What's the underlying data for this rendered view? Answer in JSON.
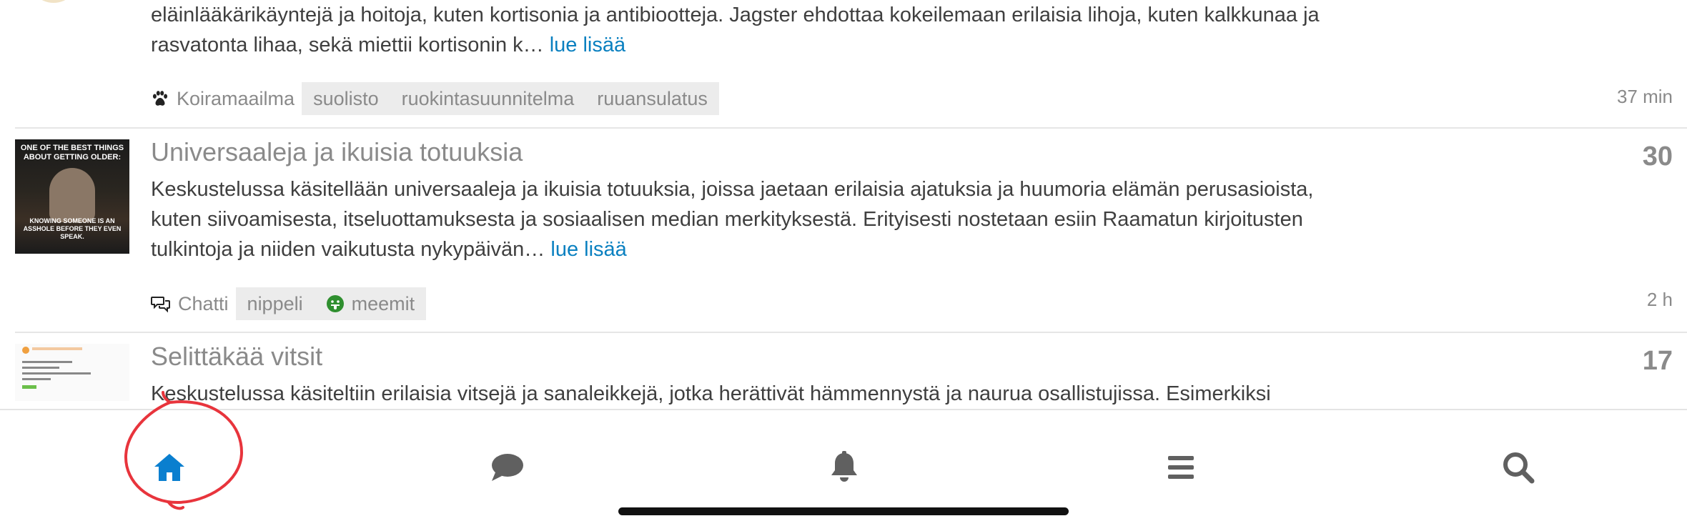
{
  "topics": [
    {
      "excerpt": "eläinlääkärikäyntejä ja hoitoja, kuten kortisonia ja antibiootteja. Jagster ehdottaa kokeilemaan erilaisia lihoja, kuten kalkkunaa ja rasvatonta lihaa, sekä miettii kortisonin k…",
      "more": "lue lisää",
      "category": "Koiramaailma",
      "category_icon": "paw-icon",
      "tags": [
        "suolisto",
        "ruokintasuunnitelma",
        "ruuansulatus"
      ],
      "age": "37 min"
    },
    {
      "title": "Universaaleja ja ikuisia totuuksia",
      "excerpt": "Keskustelussa käsitellään universaaleja ja ikuisia totuuksia, joissa jaetaan erilaisia ajatuksia ja huumoria elämän perusasioista, kuten siivoamisesta, itseluottamuksesta ja sosiaalisen median merkityksestä. Erityisesti nostetaan esiin Raamatun kirjoitusten tulkintoja ja niiden vaikutusta nykypäivän…",
      "more": "lue lisää",
      "category": "Chatti",
      "category_icon": "chat-bubbles-icon",
      "tags": [
        "nippeli",
        "meemit"
      ],
      "replies": "30",
      "age": "2 h",
      "thumb_text_top": "ONE OF THE BEST THINGS ABOUT GETTING OLDER:",
      "thumb_text_bottom": "KNOWING SOMEONE IS AN ASSHOLE BEFORE THEY EVEN SPEAK."
    },
    {
      "title": "Selittäkää vitsit",
      "excerpt": "Keskustelussa käsiteltiin erilaisia vitsejä ja sanaleikkejä, jotka herättivät hämmennystä ja naurua osallistujissa. Esimerkiksi",
      "replies": "17"
    }
  ],
  "nav": [
    {
      "name": "home-icon",
      "color": "#0a7fcf",
      "active": true
    },
    {
      "name": "chat-icon",
      "color": "#606060"
    },
    {
      "name": "bell-icon",
      "color": "#606060"
    },
    {
      "name": "menu-icon",
      "color": "#606060"
    },
    {
      "name": "search-icon",
      "color": "#606060"
    }
  ],
  "colors": {
    "accent": "#0a80c0",
    "meta": "#8a8a8a",
    "annotation": "#e8343c"
  }
}
